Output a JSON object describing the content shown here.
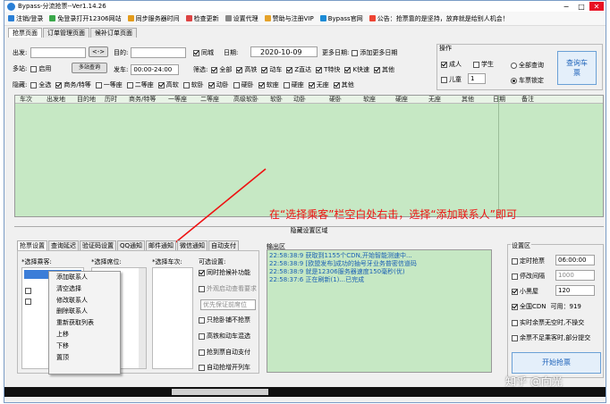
{
  "window": {
    "title": "Bypass-分流抢票--Ver1.14.26"
  },
  "menu": [
    "注销/登录",
    "免登录打开12306网站",
    "同步服务器时间",
    "检查更新",
    "设置代理",
    "赞助与注册VIP",
    "Bypass官网",
    "公告：抢票靠的是坚持，放弃就是给别人机会！"
  ],
  "tabs": [
    "抢票页面",
    "订单管理页面",
    "候补订单页面"
  ],
  "query": {
    "from_label": "出发:",
    "swap_label": "<->",
    "to_label": "目的:",
    "same_city": "同城",
    "date_label": "日期:",
    "date_value": "2020-10-09",
    "more_dates_label": "更多日期:",
    "add_more_dates": "添加更多日期",
    "multi_station_label": "多站:",
    "enable_label": "启用",
    "multi_station_btn": "多站查询",
    "depart_label": "发车:",
    "depart_value": "00:00-24:00",
    "filter_label": "筛选:",
    "train_types": [
      "全部",
      "高铁",
      "动车",
      "Z直达",
      "T特快",
      "K快速",
      "其他"
    ],
    "hide_label": "隐藏:",
    "seat_types": [
      "全选",
      "商务/特等",
      "一等座",
      "二等座",
      "高软",
      "软卧",
      "动卧",
      "硬卧",
      "软座",
      "硬座",
      "无座",
      "其他"
    ]
  },
  "operation": {
    "title": "操作",
    "adult": "成人",
    "student": "学生",
    "child": "儿童",
    "child_count": "1",
    "full_query": "全部查询",
    "station_lock": "车票锁定",
    "query_btn": "查询车票"
  },
  "grid": {
    "headers": [
      "车次",
      "出发地",
      "目的地",
      "历时",
      "商务/特等",
      "一等座",
      "二等座",
      "高级软卧",
      "软卧",
      "动卧",
      "硬卧",
      "软座",
      "硬座",
      "无座",
      "其他",
      "日期",
      "备注"
    ]
  },
  "hidden_settings_label": "隐藏设置区域",
  "annotation": "在“选择乘客”栏空白处右击，选择“添加联系人”即可",
  "bottom_tabs": [
    "抢票设置",
    "查询延迟",
    "验证码设置",
    "QQ通知",
    "邮件通知",
    "微信通知",
    "自动支付"
  ],
  "passenger_title": "*选择乘客:",
  "seat_title": "*选择席位:",
  "train_title": "*选择车次:",
  "optional": {
    "title": "可选设置:",
    "items": [
      "同时抢候补功能",
      "外观启动查看要求",
      "优先保证前席位",
      "只抢卧铺不抢票",
      "高铁和动车混选",
      "抢到票自动支付",
      "自动抢增开列车"
    ]
  },
  "context_menu": [
    "添加联系人",
    "清空选择",
    "修改联系人",
    "删除联系人",
    "重新获取列表",
    "上移",
    "下移",
    "置顶"
  ],
  "log": {
    "title": "输出区",
    "lines": [
      "22:58:38:9  获取到1155个CDN,开始智能测速中...",
      "22:58:38:9  [欧盟发布]成功的抽号牙业务普密信道码",
      "22:58:38:9  就是12306服务器速度150毫秒(优)",
      "22:58:37:6  正在刷新(1)...已完成"
    ]
  },
  "settings": {
    "title": "设置区",
    "timed_label": "定时抢票",
    "timed_value": "06:00:00",
    "interval_label": "停改间隔",
    "interval_value": "1000",
    "small_label": "小黑屋",
    "small_value": "120",
    "cdn_label": "全国CDN",
    "cdn_available": "可用：919",
    "real_label": "实时余票无空时,不操交",
    "insufficient_label": "余票不足乘客时,部分提交",
    "start_btn": "开始抢票"
  },
  "watermark": "知乎 @向光"
}
